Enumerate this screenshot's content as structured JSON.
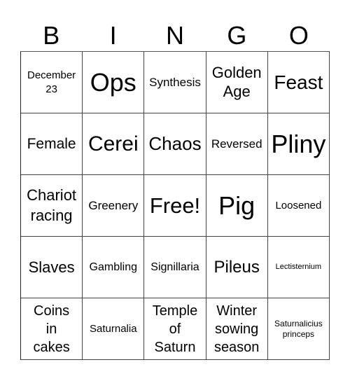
{
  "header": [
    "B",
    "I",
    "N",
    "G",
    "O"
  ],
  "cells": [
    [
      "December 23",
      "Ops",
      "Synthesis",
      "Golden Age",
      "Feast"
    ],
    [
      "Female",
      "Cerei",
      "Chaos",
      "Reversed",
      "Pliny"
    ],
    [
      "Chariot racing",
      "Greenery",
      "Free!",
      "Pig",
      "Loosened"
    ],
    [
      "Slaves",
      "Gambling",
      "Signillaria",
      "Pileus",
      "Lectisternium"
    ],
    [
      "Coins in cakes",
      "Saturnalia",
      "Temple of Saturn",
      "Winter sowing season",
      "Saturnalicius princeps"
    ]
  ]
}
